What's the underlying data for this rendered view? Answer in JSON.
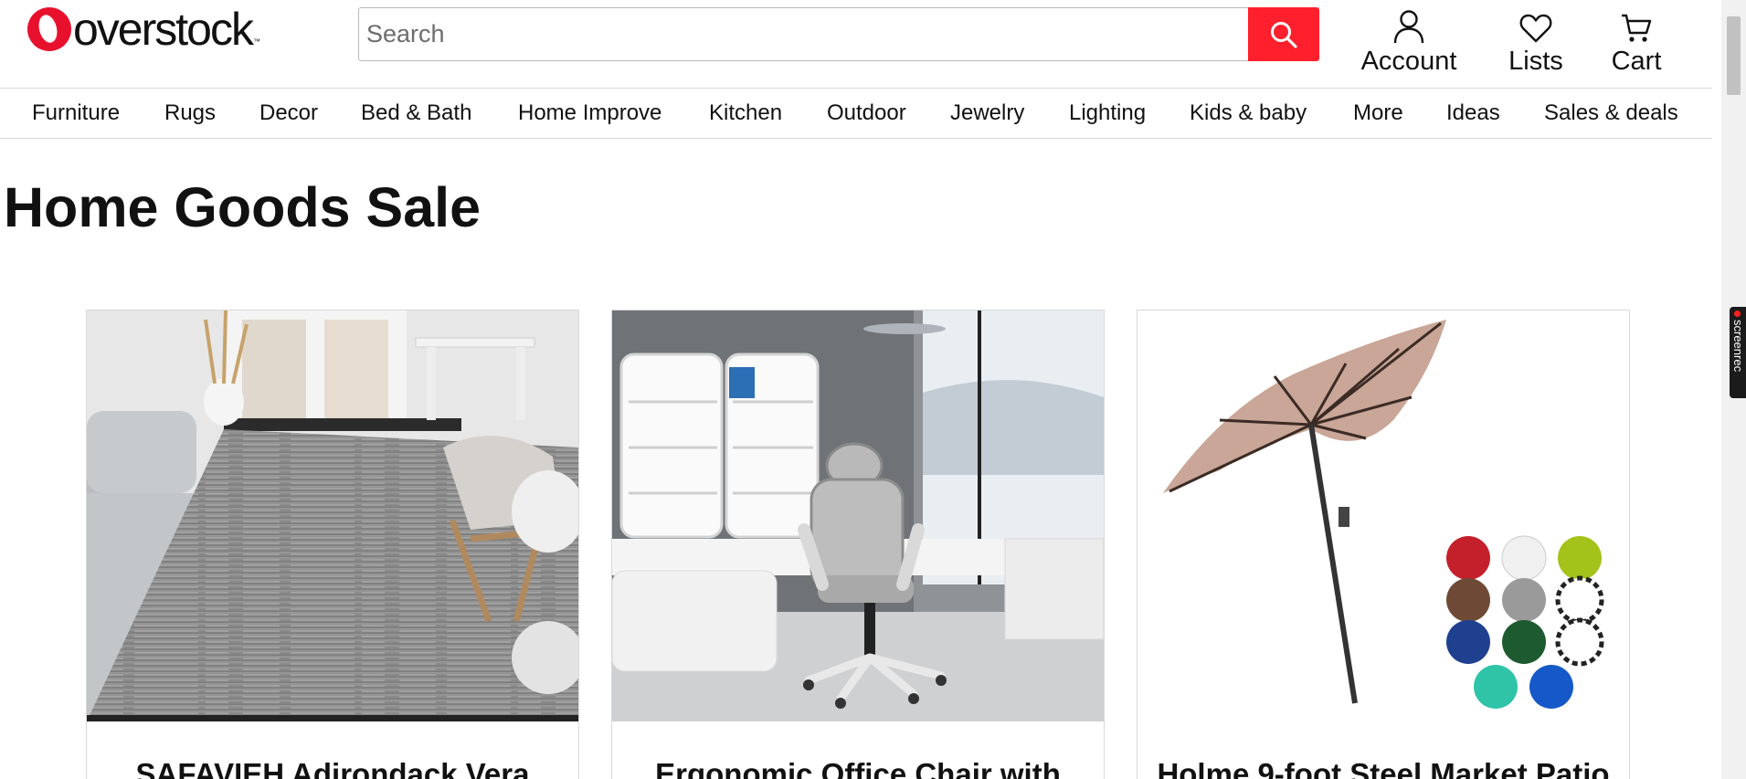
{
  "brand": {
    "name": "overstock",
    "trademark": "™",
    "colors": {
      "accent": "#ff1f2d",
      "logo": "#e8112d"
    }
  },
  "search": {
    "placeholder": "Search",
    "value": "",
    "icon": "search-icon"
  },
  "header_links": [
    {
      "label": "Account",
      "icon": "user-icon"
    },
    {
      "label": "Lists",
      "icon": "heart-icon"
    },
    {
      "label": "Cart",
      "icon": "cart-icon"
    }
  ],
  "nav": {
    "items": [
      "Furniture",
      "Rugs",
      "Decor",
      "Bed & Bath",
      "Home Improve",
      "Kitchen",
      "Outdoor",
      "Jewelry",
      "Lighting",
      "Kids & baby",
      "More",
      "Ideas",
      "Sales & deals"
    ]
  },
  "page": {
    "title": "Home Goods Sale"
  },
  "products": [
    {
      "title": "SAFAVIEH Adirondack Vera",
      "image": "area-rug-living-room-photo"
    },
    {
      "title": "Ergonomic Office Chair with",
      "image": "office-chair-photo"
    },
    {
      "title": "Holme 9-foot Steel Market Patio",
      "image": "patio-umbrella-photo"
    }
  ],
  "overlay": {
    "screenrec_label": "screenrec"
  }
}
